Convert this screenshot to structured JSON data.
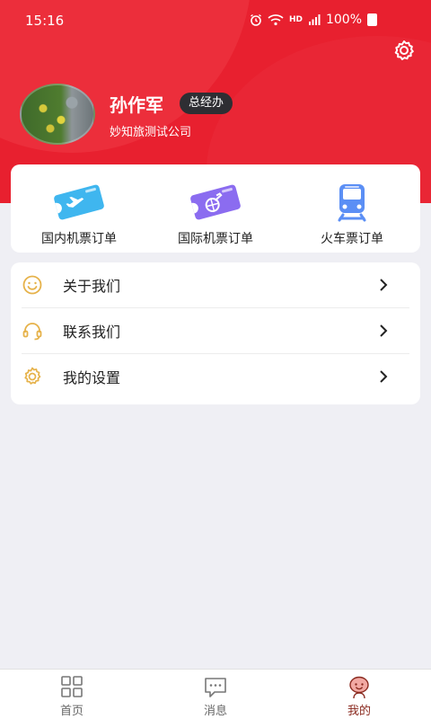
{
  "status_bar": {
    "time": "15:16",
    "signal_text": "HD",
    "battery": "100%"
  },
  "profile": {
    "name": "孙作军",
    "role": "总经办",
    "company": "妙知旅测试公司"
  },
  "orders": [
    {
      "label": "国内机票订单",
      "icon": "domestic-ticket-icon",
      "color": "#3fb6ef"
    },
    {
      "label": "国际机票订单",
      "icon": "international-ticket-icon",
      "color": "#8b6cf0"
    },
    {
      "label": "火车票订单",
      "icon": "train-icon",
      "color": "#5b8ff5"
    }
  ],
  "menu": [
    {
      "label": "关于我们",
      "icon": "smile-icon"
    },
    {
      "label": "联系我们",
      "icon": "headset-icon"
    },
    {
      "label": "我的设置",
      "icon": "gear-icon"
    }
  ],
  "tabs": [
    {
      "label": "首页",
      "icon": "grid-icon",
      "active": false
    },
    {
      "label": "消息",
      "icon": "message-icon",
      "active": false
    },
    {
      "label": "我的",
      "icon": "profile-icon",
      "active": true
    }
  ],
  "colors": {
    "brand": "#e8202f",
    "menu_icon": "#e6b24a",
    "active_tab": "#8a2a1f"
  }
}
